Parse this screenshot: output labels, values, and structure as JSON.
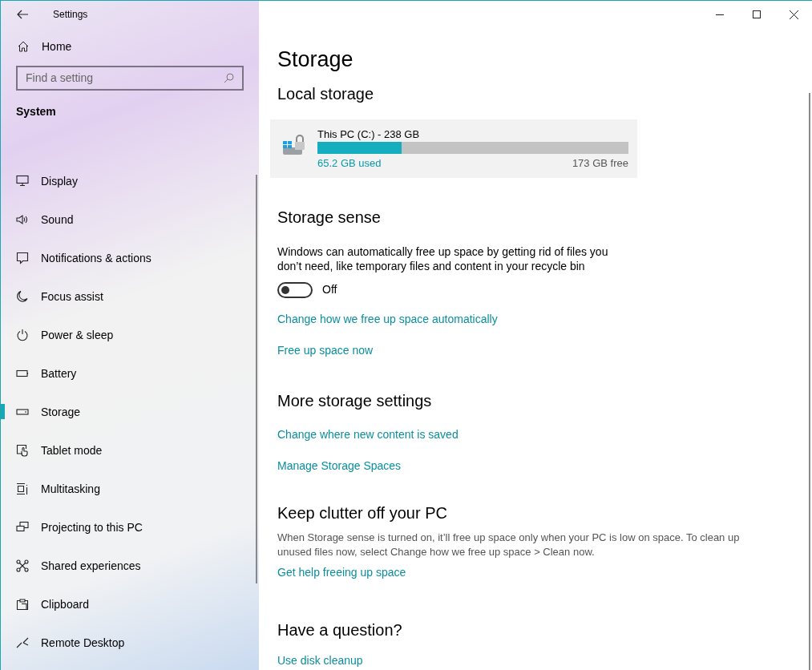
{
  "window": {
    "title": "Settings"
  },
  "sidebar": {
    "home": "Home",
    "search": {
      "placeholder": "Find a setting"
    },
    "section": "System",
    "items": [
      {
        "label": "Display",
        "selected": false
      },
      {
        "label": "Sound",
        "selected": false
      },
      {
        "label": "Notifications & actions",
        "selected": false
      },
      {
        "label": "Focus assist",
        "selected": false
      },
      {
        "label": "Power & sleep",
        "selected": false
      },
      {
        "label": "Battery",
        "selected": false
      },
      {
        "label": "Storage",
        "selected": true
      },
      {
        "label": "Tablet mode",
        "selected": false
      },
      {
        "label": "Multitasking",
        "selected": false
      },
      {
        "label": "Projecting to this PC",
        "selected": false
      },
      {
        "label": "Shared experiences",
        "selected": false
      },
      {
        "label": "Clipboard",
        "selected": false
      },
      {
        "label": "Remote Desktop",
        "selected": false
      }
    ]
  },
  "page": {
    "title": "Storage",
    "local_storage": {
      "heading": "Local storage",
      "drive": {
        "name": "This PC (C:) - 238 GB",
        "level": 0.27,
        "used": "65.2 GB used",
        "free": "173 GB free"
      }
    },
    "storage_sense": {
      "heading": "Storage sense",
      "description": "Windows can automatically free up space by getting rid of files you don’t need, like temporary files and content in your recycle bin",
      "toggle": {
        "on": false,
        "label": "Off"
      },
      "links": [
        "Change how we free up space automatically",
        "Free up space now"
      ]
    },
    "more_settings": {
      "heading": "More storage settings",
      "links": [
        "Change where new content is saved",
        "Manage Storage Spaces"
      ]
    },
    "clutter": {
      "heading": "Keep clutter off your PC",
      "description": "When Storage sense is turned on, it’ll free up space only when your PC is low on space. To clean up unused files now, select Change how we free up space > Clean now.",
      "links": [
        "Get help freeing up space"
      ]
    },
    "question": {
      "heading": "Have a question?",
      "links": [
        "Use disk cleanup"
      ]
    }
  }
}
